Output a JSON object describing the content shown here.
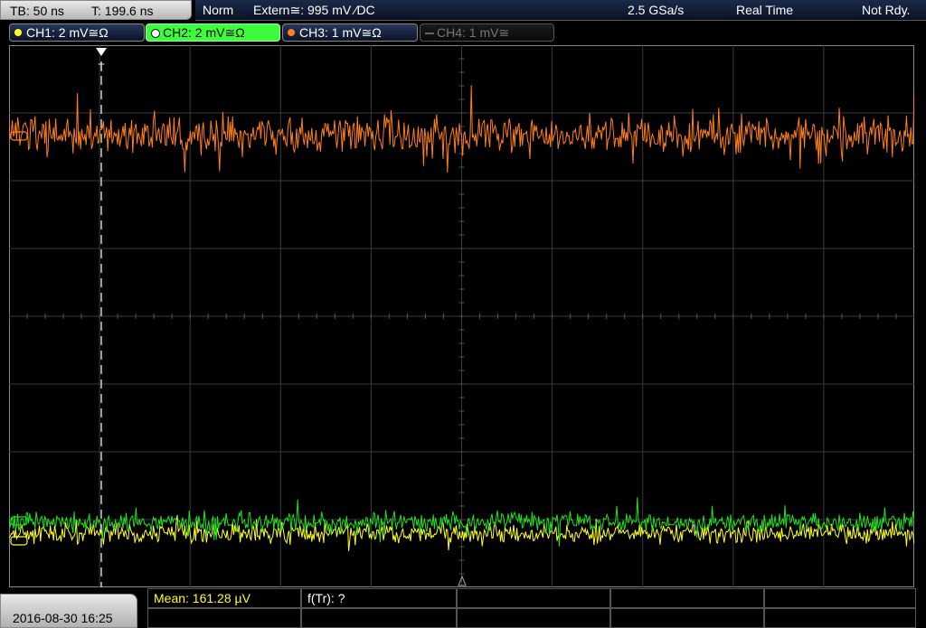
{
  "header": {
    "timebase": "TB: 50 ns",
    "trigger_time": "T: 199.6 ns",
    "trigger_mode": "Norm",
    "trigger_source": "Extern≅: 995 mV ⁄DC",
    "sample_rate": "2.5 GSa/s",
    "acq_mode": "Real Time",
    "status": "Not Rdy."
  },
  "channels": [
    {
      "label": "CH1: 2 mV≅Ω",
      "color": "#ffff22",
      "state": "on"
    },
    {
      "label": "CH2: 2 mV≅Ω",
      "color": "#22e022",
      "state": "active"
    },
    {
      "label": "CH3: 1 mV≅Ω",
      "color": "#ff8020",
      "state": "on"
    },
    {
      "label": "CH4: 1 mV≅",
      "color": "#777777",
      "state": "off"
    }
  ],
  "footer": {
    "datetime": "2016-08-30 16:25",
    "measurement_mean": "Mean: 161.28 µV",
    "measurement_freq": "f(Tr): ?"
  },
  "colors": {
    "ch3_trace": "#ff7f1a",
    "ch2_trace": "#22e022",
    "ch1_trace": "#ffff22",
    "grid": "#3a3a3a"
  },
  "icons": [
    "trigger-marker-icon",
    "ground-marker-icon",
    "trigger-level-icon"
  ]
}
